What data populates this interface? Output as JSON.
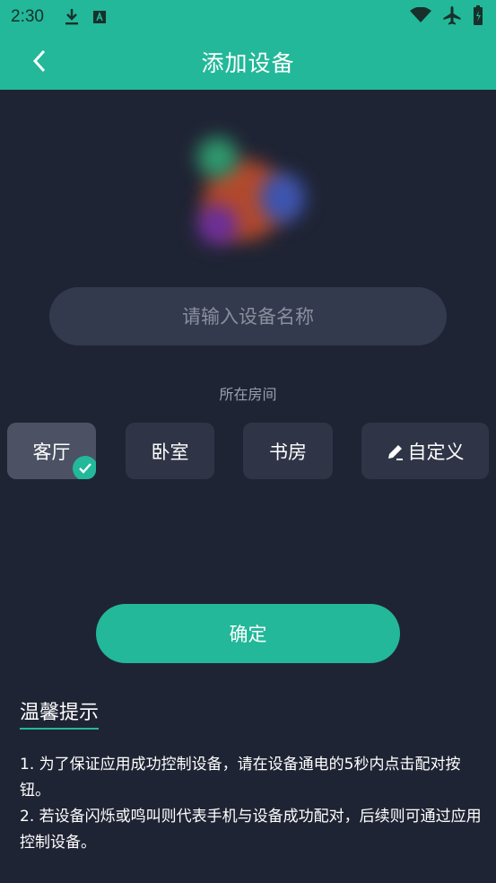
{
  "status_bar": {
    "time": "2:30",
    "icons_left": [
      "download-icon",
      "a-box-icon"
    ],
    "icons_right": [
      "wifi-icon",
      "airplane-icon",
      "battery-icon"
    ]
  },
  "header": {
    "title": "添加设备",
    "back_icon": "chevron-left-icon"
  },
  "device_name": {
    "placeholder": "请输入设备名称",
    "value": ""
  },
  "room": {
    "label": "所在房间",
    "options": [
      {
        "label": "客厅",
        "selected": true
      },
      {
        "label": "卧室",
        "selected": false
      },
      {
        "label": "书房",
        "selected": false
      },
      {
        "label": "自定义",
        "selected": false,
        "icon": "pencil-icon"
      }
    ]
  },
  "confirm_label": "确定",
  "tips": {
    "title": "温馨提示",
    "line1": "1. 为了保证应用成功控制设备，请在设备通电的5秒内点击配对按钮。",
    "line2": "2. 若设备闪烁或鸣叫则代表手机与设备成功配对，后续则可通过应用控制设备。"
  },
  "colors": {
    "accent": "#22b899",
    "background": "#1f2434",
    "card": "#2f3546",
    "card_selected": "#4c5264",
    "input": "#343a4d"
  }
}
